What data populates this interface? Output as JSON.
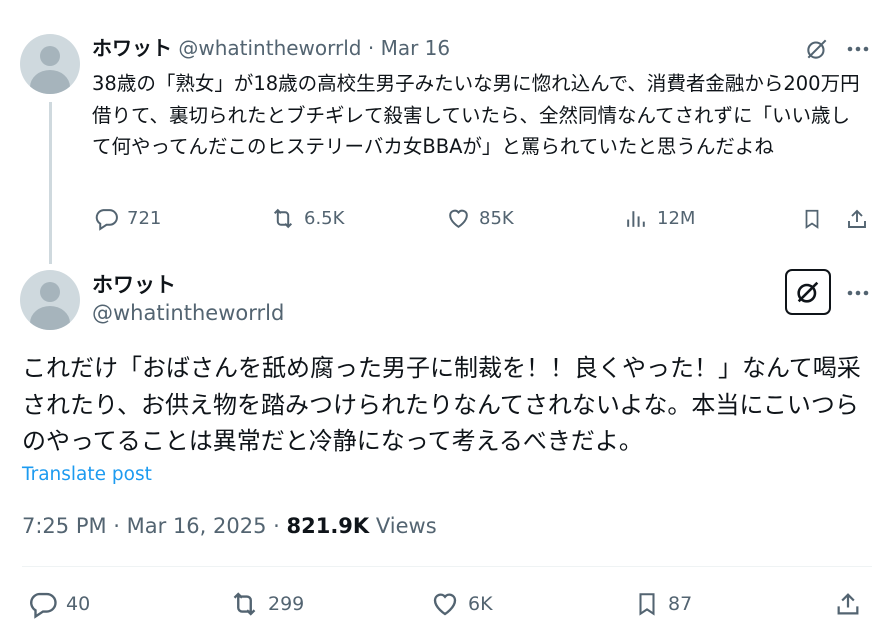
{
  "parent_tweet": {
    "display_name": "ホワット",
    "handle": "@whatintheworrld",
    "separator": "·",
    "date": "Mar 16",
    "text": "38歳の「熟女」が18歳の高校生男子みたいな男に惚れ込んで、消費者金融から200万円借りて、裏切られたとブチギレて殺害していたら、全然同情なんてされずに「いい歳して何やってんだこのヒステリーバカ女BBAが」と罵られていたと思うんだよね",
    "replies": "721",
    "reposts": "6.5K",
    "likes": "85K",
    "views": "12M"
  },
  "main_tweet": {
    "display_name": "ホワット",
    "handle": "@whatintheworrld",
    "text": "これだけ「おばさんを舐め腐った男子に制裁を！！良くやった！」なんて喝采されたり、お供え物を踏みつけられたりなんてされないよな。本当にこいつらのやってることは異常だと冷静になって考えるべきだよ。",
    "translate_label": "Translate post",
    "time": "7:25 PM · Mar 16, 2025 · ",
    "views_count": "821.9K",
    "views_label": " Views",
    "replies": "40",
    "reposts": "299",
    "likes": "6K",
    "bookmarks": "87"
  },
  "icons": [
    "grok-icon",
    "more-icon",
    "reply-icon",
    "repost-icon",
    "like-icon",
    "views-icon",
    "bookmark-icon",
    "share-icon"
  ]
}
